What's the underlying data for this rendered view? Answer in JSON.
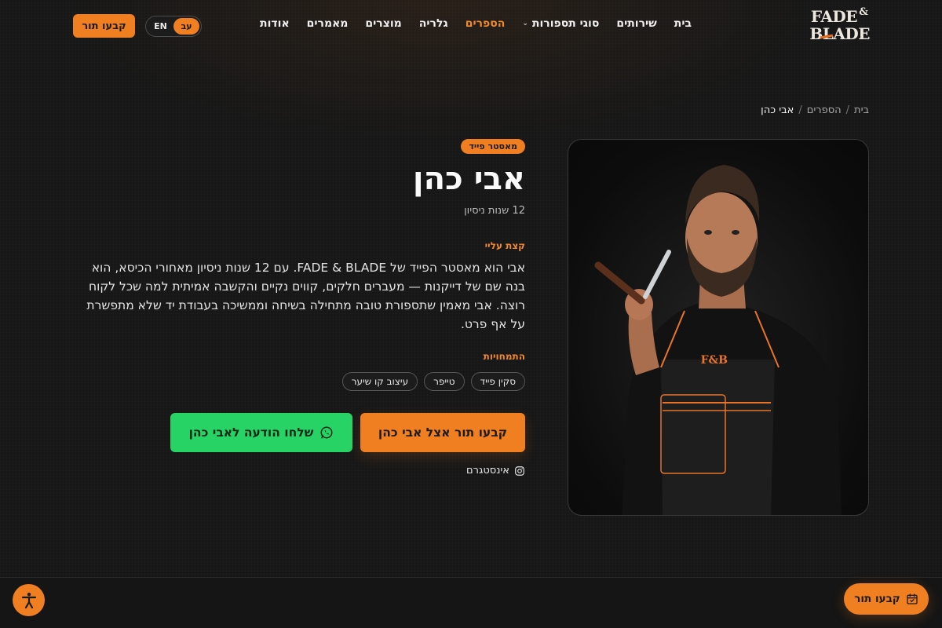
{
  "brand": {
    "logo_line1": "FADE",
    "logo_amp": "&",
    "logo_line2": "BLADE",
    "accent": "#f07f22",
    "whatsapp_color": "#28d366"
  },
  "nav": {
    "items": [
      {
        "label": "בית"
      },
      {
        "label": "שירותים"
      },
      {
        "label": "סוגי תספורות",
        "has_dropdown": true
      },
      {
        "label": "הספרים",
        "active": true
      },
      {
        "label": "גלריה"
      },
      {
        "label": "מוצרים"
      },
      {
        "label": "מאמרים"
      },
      {
        "label": "אודות"
      }
    ],
    "dropdown_icon": "chevron-down-icon"
  },
  "lang": {
    "he": "עב",
    "en": "EN",
    "selected": "he"
  },
  "header_cta": "קבעו תור",
  "breadcrumb": {
    "home": "בית",
    "sep": "/",
    "barbers": "הספרים",
    "current": "אבי כהן"
  },
  "barber": {
    "badge": "מאסטר פייד",
    "name": "אבי כהן",
    "experience": "12 שנות ניסיון",
    "about_label": "קצת עליי",
    "bio": "אבי הוא מאסטר הפייד של FADE & BLADE. עם 12 שנות ניסיון מאחורי הכיסא, הוא בנה שם של דייקנות — מעברים חלקים, קווים נקיים והקשבה אמיתית למה שכל לקוח רוצה. אבי מאמין שתספורת טובה מתחילה בשיחה וממשיכה בעבודת יד שלא מתפשרת על אף פרט.",
    "spec_label": "התמחויות",
    "specialties": [
      "סקין פייד",
      "טייפר",
      "עיצוב קו שיער"
    ],
    "book_button": "קבעו תור אצל אבי כהן",
    "whatsapp_button": "שלחו הודעה לאבי כהן",
    "instagram": "אינסטגרם"
  },
  "floating": {
    "book": "קבעו תור",
    "book_icon": "calendar-icon",
    "accessibility_icon": "accessibility-icon"
  }
}
